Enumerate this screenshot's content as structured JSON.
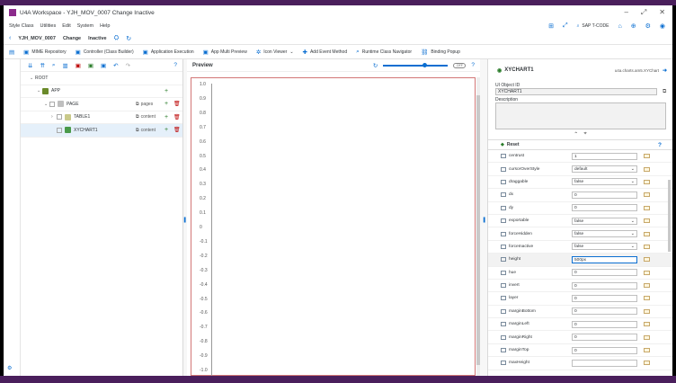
{
  "window": {
    "title": "U4A Workspace - YJH_MOV_0007 Change Inactive"
  },
  "menu": {
    "items": [
      "Style Class",
      "Utilities",
      "Edit",
      "System",
      "Help"
    ],
    "tcode_placeholder": "SAP T-CODE"
  },
  "object": {
    "name": "YJH_MOV_0007",
    "mode": "Change",
    "status": "Inactive"
  },
  "toolbar": {
    "items": [
      "MIME Repository",
      "Controller (Class Builder)",
      "Application Execution",
      "App Multi Preview",
      "Icon Viewer",
      "Add Event Method",
      "Runtime Class Navigator",
      "Binding Popup"
    ]
  },
  "tree": {
    "rows": [
      {
        "label": "ROOT",
        "agg": "",
        "level": 0,
        "color": ""
      },
      {
        "label": "APP",
        "agg": "",
        "level": 1,
        "color": "#6a8a2a"
      },
      {
        "label": "PAGE",
        "agg": "pages",
        "level": 2,
        "color": "#bfbfbf"
      },
      {
        "label": "TABLE1",
        "agg": "content",
        "level": 3,
        "color": "#c9c98a"
      },
      {
        "label": "XYCHART1",
        "agg": "content",
        "level": 3,
        "color": "#4a9a4a"
      }
    ]
  },
  "preview": {
    "title": "Preview",
    "toggle": "OFF",
    "y_ticks": [
      "1.0",
      "0.9",
      "0.8",
      "0.7",
      "0.6",
      "0.5",
      "0.4",
      "0.3",
      "0.2",
      "0.1",
      "0",
      "-0.1",
      "-0.2",
      "-0.3",
      "-0.4",
      "-0.5",
      "-0.6",
      "-0.7",
      "-0.8",
      "-0.9",
      "-1.0"
    ]
  },
  "props": {
    "object_name": "XYCHART1",
    "class_name": "u4a.charts.am5.XYChart",
    "ui_object_id_label": "UI Object ID",
    "ui_object_id": "XYCHART1",
    "description_label": "Description",
    "reset_label": "Reset",
    "rows": [
      {
        "name": "centrust",
        "value": "1",
        "dropdown": false
      },
      {
        "name": "cursorOverStyle",
        "value": "default",
        "dropdown": true
      },
      {
        "name": "draggable",
        "value": "false",
        "dropdown": true
      },
      {
        "name": "dx",
        "value": "0",
        "dropdown": false
      },
      {
        "name": "dy",
        "value": "0",
        "dropdown": false
      },
      {
        "name": "exportable",
        "value": "false",
        "dropdown": true
      },
      {
        "name": "forceHidden",
        "value": "false",
        "dropdown": true
      },
      {
        "name": "forceInactive",
        "value": "false",
        "dropdown": true
      },
      {
        "name": "height",
        "value": "500px",
        "dropdown": false
      },
      {
        "name": "hue",
        "value": "0",
        "dropdown": false
      },
      {
        "name": "invert",
        "value": "0",
        "dropdown": false
      },
      {
        "name": "layer",
        "value": "0",
        "dropdown": false
      },
      {
        "name": "marginBottom",
        "value": "0",
        "dropdown": false
      },
      {
        "name": "marginLeft",
        "value": "0",
        "dropdown": false
      },
      {
        "name": "marginRight",
        "value": "0",
        "dropdown": false
      },
      {
        "name": "marginTop",
        "value": "0",
        "dropdown": false
      },
      {
        "name": "maxHeight",
        "value": "",
        "dropdown": false
      }
    ]
  }
}
